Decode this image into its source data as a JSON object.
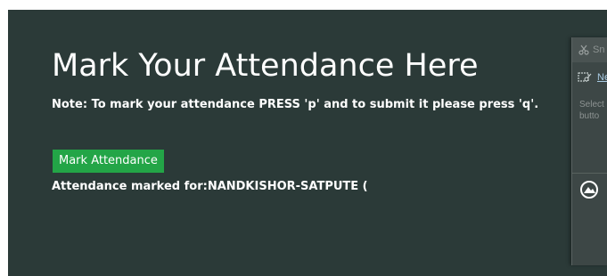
{
  "page": {
    "title": "Mark Your Attendance Here",
    "note": "Note: To mark your attendance PRESS 'p' and to submit it please press 'q'.",
    "mark_button_label": "Mark Attendance",
    "marked_for": "Attendance marked for:NANDKISHOR-SATPUTE ("
  },
  "snipping_tool": {
    "title_fragment": "Sn",
    "new_button_fragment": "Ne",
    "description_lines": [
      "Select",
      "butto"
    ],
    "icons": {
      "app": "scissors-icon",
      "new": "new-snip-icon",
      "mode": "snip-mode-icon"
    }
  },
  "colors": {
    "background": "#2b3a38",
    "button": "#23a547",
    "text": "#ffffff"
  }
}
